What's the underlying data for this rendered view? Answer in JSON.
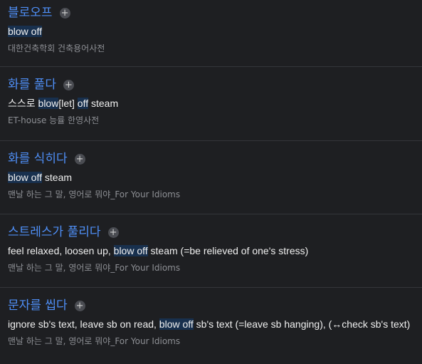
{
  "entries": [
    {
      "title": "블로오프",
      "add_icon": "plus-icon",
      "meaning": [
        {
          "t": "blow off",
          "hl": true
        }
      ],
      "source": "대한건축학회 건축용어사전"
    },
    {
      "title": "화를 풀다",
      "add_icon": "plus-icon",
      "meaning": [
        {
          "t": "스스로 ",
          "hl": false
        },
        {
          "t": "blow",
          "hl": true
        },
        {
          "t": "[let] ",
          "hl": false
        },
        {
          "t": "off",
          "hl": true
        },
        {
          "t": " steam",
          "hl": false
        }
      ],
      "source": "ET-house 능률 한영사전"
    },
    {
      "title": "화를 식히다",
      "add_icon": "plus-icon",
      "meaning": [
        {
          "t": "blow off",
          "hl": true
        },
        {
          "t": " steam",
          "hl": false
        }
      ],
      "source": "맨날 하는 그 말, 영어로 뭐야_For Your Idioms"
    },
    {
      "title": "스트레스가 풀리다",
      "add_icon": "plus-icon",
      "meaning": [
        {
          "t": "feel relaxed, loosen up, ",
          "hl": false
        },
        {
          "t": "blow off",
          "hl": true
        },
        {
          "t": " steam (=be relieved of one's stress)",
          "hl": false
        }
      ],
      "source": "맨날 하는 그 말, 영어로 뭐야_For Your Idioms"
    },
    {
      "title": "문자를 씹다",
      "add_icon": "plus-icon",
      "meaning": [
        {
          "t": "ignore sb's text, leave sb on read, ",
          "hl": false
        },
        {
          "t": "blow off",
          "hl": true
        },
        {
          "t": " sb's text (=leave sb hanging), (↔check sb's text)",
          "hl": false
        }
      ],
      "source": "맨날 하는 그 말, 영어로 뭐야_For Your Idioms"
    }
  ],
  "colors": {
    "background": "#1e1f22",
    "title": "#4f8ff7",
    "highlight": "#18304e",
    "source": "#8d8f94",
    "divider": "#34363a"
  }
}
